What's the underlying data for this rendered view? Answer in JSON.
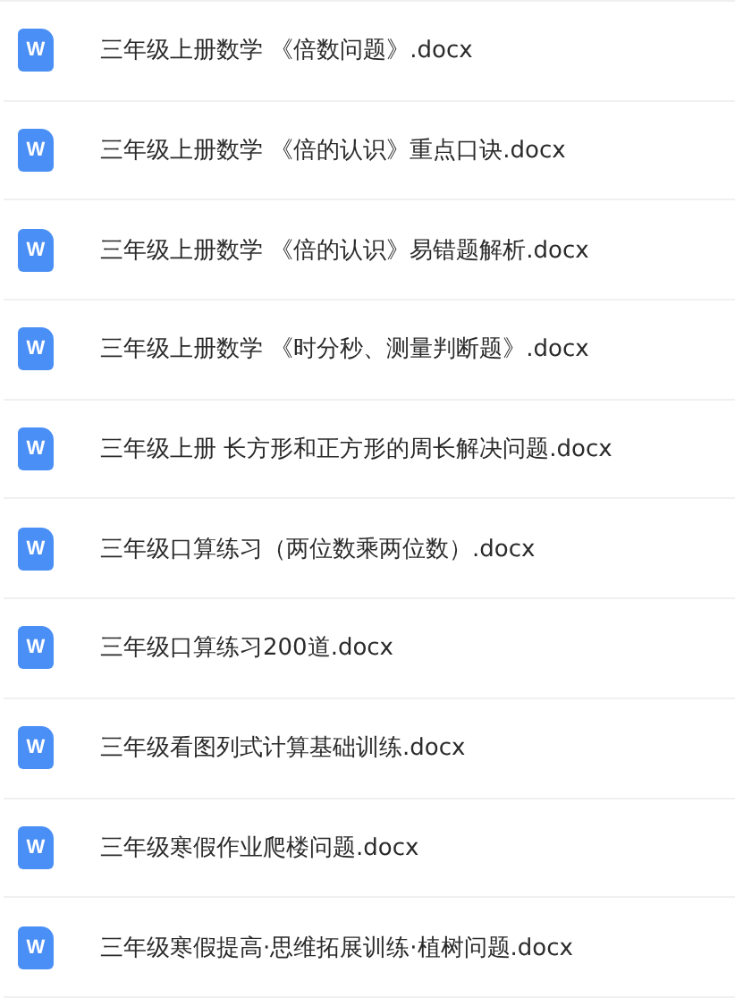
{
  "files": [
    {
      "icon_letter": "W",
      "name": "三年级上册数学 《倍数问题》.docx"
    },
    {
      "icon_letter": "W",
      "name": "三年级上册数学 《倍的认识》重点口诀.docx"
    },
    {
      "icon_letter": "W",
      "name": "三年级上册数学 《倍的认识》易错题解析.docx"
    },
    {
      "icon_letter": "W",
      "name": "三年级上册数学 《时分秒、测量判断题》.docx"
    },
    {
      "icon_letter": "W",
      "name": "三年级上册 长方形和正方形的周长解决问题.docx"
    },
    {
      "icon_letter": "W",
      "name": "三年级口算练习（两位数乘两位数）.docx"
    },
    {
      "icon_letter": "W",
      "name": "三年级口算练习200道.docx"
    },
    {
      "icon_letter": "W",
      "name": "三年级看图列式计算基础训练.docx"
    },
    {
      "icon_letter": "W",
      "name": "三年级寒假作业爬楼问题.docx"
    },
    {
      "icon_letter": "W",
      "name": "三年级寒假提高·思维拓展训练·植树问题.docx"
    }
  ]
}
